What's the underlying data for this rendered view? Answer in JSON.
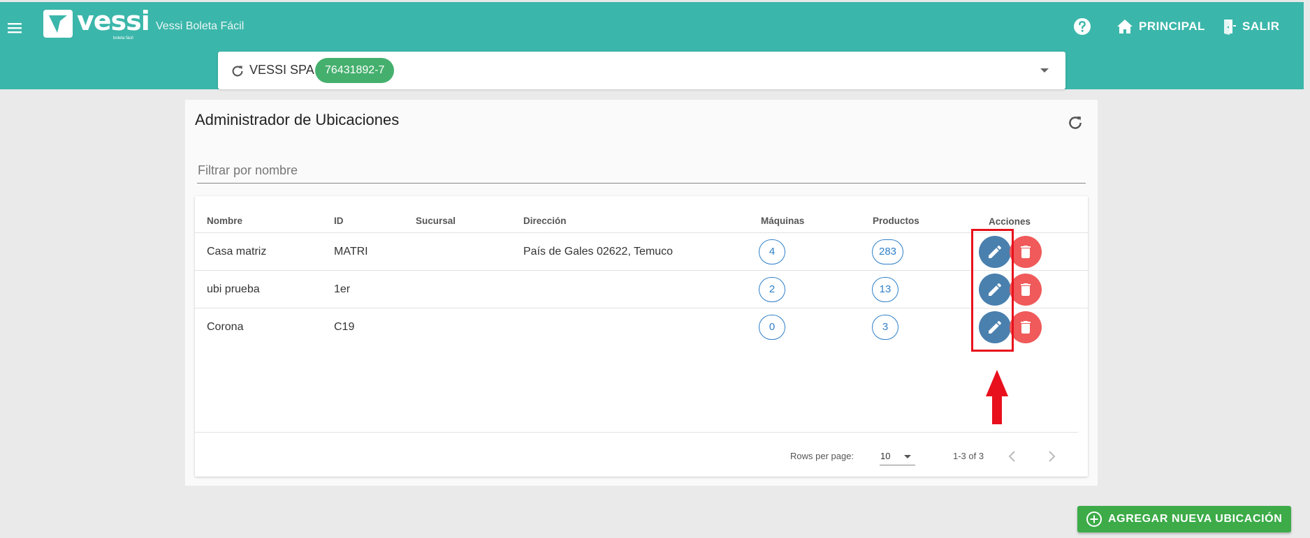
{
  "header": {
    "logo_text": "vessi",
    "logo_sub": "boleta fácil",
    "app_title": "Vessi Boleta Fácil",
    "principal_label": "PRINCIPAL",
    "salir_label": "SALIR",
    "icons": [
      "menu-icon",
      "help-icon",
      "home-icon",
      "exit-door-icon"
    ]
  },
  "company": {
    "name": "VESSI SPA",
    "rut": "76431892-7"
  },
  "card": {
    "title": "Administrador de Ubicaciones",
    "filter_placeholder": "Filtrar por nombre"
  },
  "table": {
    "headers": {
      "nombre": "Nombre",
      "id": "ID",
      "sucursal": "Sucursal",
      "direccion": "Dirección",
      "maquinas": "Máquinas",
      "productos": "Productos",
      "acciones": "Acciones"
    },
    "rows": [
      {
        "nombre": "Casa matriz",
        "id": "MATRI",
        "sucursal": "",
        "direccion": "País de Gales 02622, Temuco",
        "maquinas": "4",
        "productos": "283"
      },
      {
        "nombre": "ubi prueba",
        "id": "1er",
        "sucursal": "",
        "direccion": "",
        "maquinas": "2",
        "productos": "13"
      },
      {
        "nombre": "Corona",
        "id": "C19",
        "sucursal": "",
        "direccion": "",
        "maquinas": "0",
        "productos": "3"
      }
    ],
    "footer": {
      "rows_per_page_label": "Rows per page:",
      "rows_per_page_value": "10",
      "range": "1-3 of 3"
    }
  },
  "fab": {
    "label": "AGREGAR NUEVA UBICACIÓN"
  },
  "colors": {
    "appbar": "#3bb6aa",
    "chip": "#45b06e",
    "pill_blue": "#2f7fc8",
    "edit_button": "#4a80ae",
    "delete_button": "#f05a5a",
    "annotation_red": "#e8101c",
    "fab_green": "#3cab48"
  }
}
